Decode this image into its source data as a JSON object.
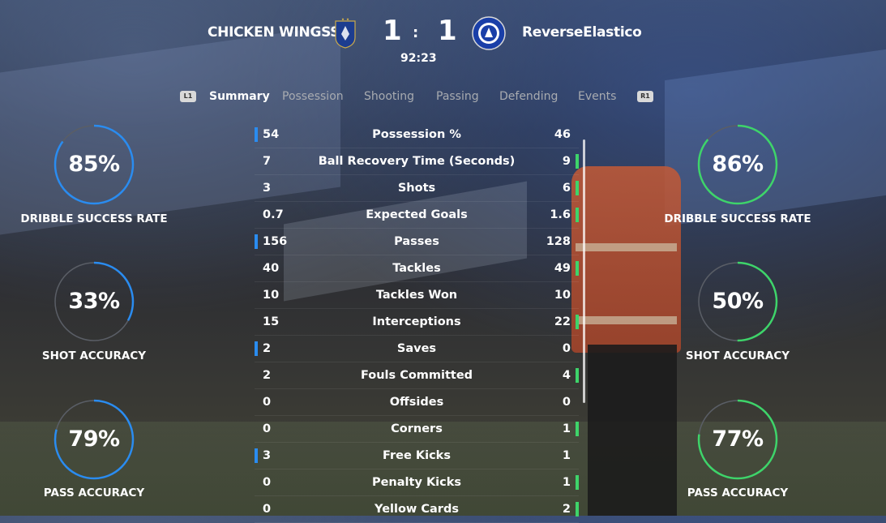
{
  "header": {
    "home_team": "CHICKEN WINGSS",
    "away_team": "ReverseElastico",
    "home_score": "1",
    "away_score": "1",
    "score_separator": ":",
    "match_clock": "92:23",
    "home_crest": "france-crest-icon",
    "away_crest": "chelsea-crest-icon"
  },
  "tabs": {
    "left_hint": "L1",
    "right_hint": "R1",
    "items": [
      "Summary",
      "Possession",
      "Shooting",
      "Passing",
      "Defending",
      "Events"
    ],
    "active": "Summary"
  },
  "home_rings": [
    {
      "value": "85%",
      "label": "DRIBBLE SUCCESS RATE",
      "fraction": 0.85
    },
    {
      "value": "33%",
      "label": "SHOT ACCURACY",
      "fraction": 0.33
    },
    {
      "value": "79%",
      "label": "PASS ACCURACY",
      "fraction": 0.79
    }
  ],
  "away_rings": [
    {
      "value": "86%",
      "label": "DRIBBLE SUCCESS RATE",
      "fraction": 0.86
    },
    {
      "value": "50%",
      "label": "SHOT ACCURACY",
      "fraction": 0.5
    },
    {
      "value": "77%",
      "label": "PASS ACCURACY",
      "fraction": 0.77
    }
  ],
  "stats": [
    {
      "label": "Possession %",
      "home": "54",
      "away": "46",
      "leader": "home"
    },
    {
      "label": "Ball Recovery Time (Seconds)",
      "home": "7",
      "away": "9",
      "leader": "away"
    },
    {
      "label": "Shots",
      "home": "3",
      "away": "6",
      "leader": "away"
    },
    {
      "label": "Expected Goals",
      "home": "0.7",
      "away": "1.6",
      "leader": "away"
    },
    {
      "label": "Passes",
      "home": "156",
      "away": "128",
      "leader": "home"
    },
    {
      "label": "Tackles",
      "home": "40",
      "away": "49",
      "leader": "away"
    },
    {
      "label": "Tackles Won",
      "home": "10",
      "away": "10",
      "leader": "none"
    },
    {
      "label": "Interceptions",
      "home": "15",
      "away": "22",
      "leader": "away"
    },
    {
      "label": "Saves",
      "home": "2",
      "away": "0",
      "leader": "home"
    },
    {
      "label": "Fouls Committed",
      "home": "2",
      "away": "4",
      "leader": "away"
    },
    {
      "label": "Offsides",
      "home": "0",
      "away": "0",
      "leader": "none"
    },
    {
      "label": "Corners",
      "home": "0",
      "away": "1",
      "leader": "away"
    },
    {
      "label": "Free Kicks",
      "home": "3",
      "away": "1",
      "leader": "home"
    },
    {
      "label": "Penalty Kicks",
      "home": "0",
      "away": "1",
      "leader": "away"
    },
    {
      "label": "Yellow Cards",
      "home": "0",
      "away": "2",
      "leader": "away"
    }
  ],
  "colors": {
    "home_accent": "#2a8cf0",
    "away_accent": "#3ed46a",
    "ring_track": "#5a5e66"
  }
}
